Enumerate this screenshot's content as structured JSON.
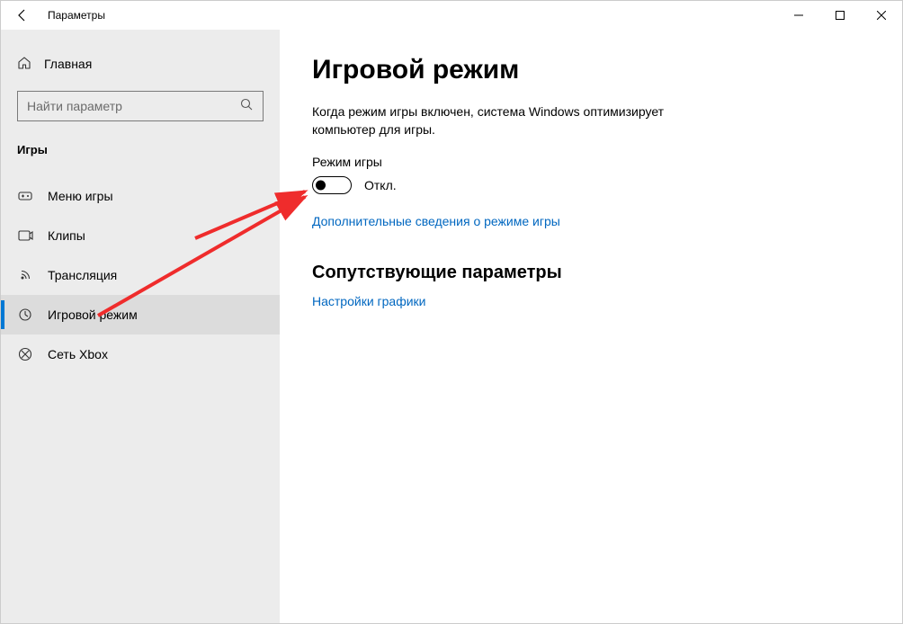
{
  "window_title": "Параметры",
  "sidebar": {
    "home_label": "Главная",
    "search_placeholder": "Найти параметр",
    "section_label": "Игры",
    "items": [
      {
        "label": "Меню игры"
      },
      {
        "label": "Клипы"
      },
      {
        "label": "Трансляция"
      },
      {
        "label": "Игровой режим"
      },
      {
        "label": "Сеть Xbox"
      }
    ]
  },
  "main": {
    "page_title": "Игровой режим",
    "description": "Когда режим игры включен, система Windows оптимизирует компьютер для игры.",
    "toggle_caption": "Режим игры",
    "toggle_state_label": "Откл.",
    "more_info_link": "Дополнительные сведения о режиме игры",
    "related_heading": "Сопутствующие параметры",
    "related_link": "Настройки графики"
  }
}
